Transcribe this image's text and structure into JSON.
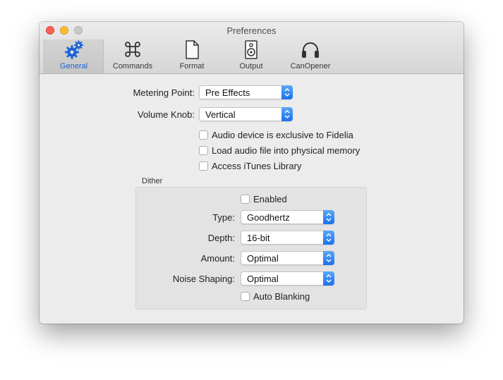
{
  "window": {
    "title": "Preferences"
  },
  "toolbar": {
    "items": [
      {
        "label": "General",
        "icon": "gears-icon",
        "selected": true
      },
      {
        "label": "Commands",
        "icon": "command-key-icon",
        "selected": false
      },
      {
        "label": "Format",
        "icon": "document-icon",
        "selected": false
      },
      {
        "label": "Output",
        "icon": "speaker-icon",
        "selected": false
      },
      {
        "label": "CanOpener",
        "icon": "headphones-icon",
        "selected": false
      }
    ]
  },
  "general": {
    "metering_point": {
      "label": "Metering Point:",
      "value": "Pre Effects"
    },
    "volume_knob": {
      "label": "Volume Knob:",
      "value": "Vertical"
    },
    "options": [
      {
        "label": "Audio device is exclusive to Fidelia",
        "checked": false
      },
      {
        "label": "Load audio file into physical memory",
        "checked": false
      },
      {
        "label": "Access iTunes Library",
        "checked": false
      }
    ]
  },
  "dither": {
    "title": "Dither",
    "enabled": {
      "label": "Enabled",
      "checked": false
    },
    "type": {
      "label": "Type:",
      "value": "Goodhertz"
    },
    "depth": {
      "label": "Depth:",
      "value": "16-bit"
    },
    "amount": {
      "label": "Amount:",
      "value": "Optimal"
    },
    "noise_shaping": {
      "label": "Noise Shaping:",
      "value": "Optimal"
    },
    "auto_blanking": {
      "label": "Auto Blanking",
      "checked": false
    }
  },
  "colors": {
    "accent": "#1b63d6",
    "popup_arrow": "#1a70ec"
  }
}
